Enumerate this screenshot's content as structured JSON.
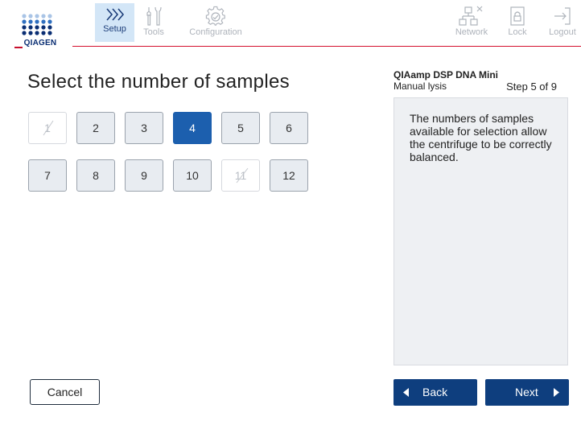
{
  "header": {
    "logo_text": "QIAGEN",
    "tabs": {
      "setup": "Setup",
      "tools": "Tools",
      "configuration": "Configuration",
      "network": "Network",
      "lock": "Lock",
      "logout": "Logout"
    },
    "active_tab": "Setup",
    "icons": {
      "setup": "chevrons-right-icon",
      "tools": "tools-icon",
      "configuration": "gear-icon",
      "network": "network-icon",
      "lock": "lock-icon",
      "logout": "logout-icon"
    }
  },
  "main": {
    "title": "Select the number of samples",
    "samples": [
      {
        "label": "1",
        "state": "disabled"
      },
      {
        "label": "2",
        "state": "enabled"
      },
      {
        "label": "3",
        "state": "enabled"
      },
      {
        "label": "4",
        "state": "selected"
      },
      {
        "label": "5",
        "state": "enabled"
      },
      {
        "label": "6",
        "state": "enabled"
      },
      {
        "label": "7",
        "state": "enabled"
      },
      {
        "label": "8",
        "state": "enabled"
      },
      {
        "label": "9",
        "state": "enabled"
      },
      {
        "label": "10",
        "state": "enabled"
      },
      {
        "label": "11",
        "state": "disabled"
      },
      {
        "label": "12",
        "state": "enabled"
      }
    ]
  },
  "side": {
    "protocol_name": "QIAamp DSP DNA Mini",
    "protocol_sub": "Manual lysis",
    "step": "Step 5 of 9",
    "info_text": "The numbers of samples available for selection allow the centrifuge to be correctly balanced."
  },
  "footer": {
    "cancel_label": "Cancel",
    "back_label": "Back",
    "next_label": "Next"
  },
  "colors": {
    "brand_red": "#d5102e",
    "brand_blue": "#0a2e73",
    "selected_blue": "#1c5fae",
    "nav_button": "#0e3e7e",
    "active_tab_bg": "#d3e6f7"
  }
}
